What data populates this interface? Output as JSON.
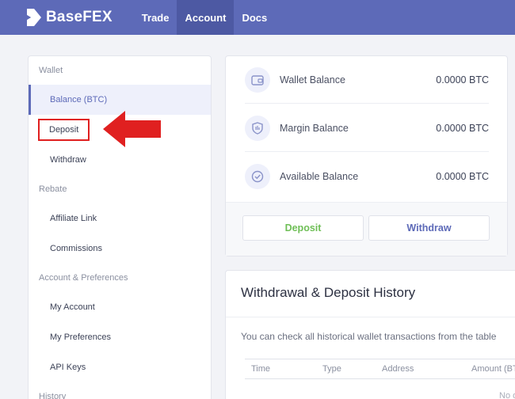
{
  "brand": {
    "name": "BaseFEX"
  },
  "nav": {
    "items": [
      {
        "label": "Trade",
        "active": false
      },
      {
        "label": "Account",
        "active": true
      },
      {
        "label": "Docs",
        "active": false
      }
    ]
  },
  "sidebar": {
    "wallet_heading": "Wallet",
    "balance_item": "Balance (BTC)",
    "deposit_item": "Deposit",
    "withdraw_item": "Withdraw",
    "rebate_heading": "Rebate",
    "affiliate_item": "Affiliate Link",
    "commissions_item": "Commissions",
    "account_heading": "Account & Preferences",
    "my_account_item": "My Account",
    "my_preferences_item": "My Preferences",
    "api_keys_item": "API Keys",
    "history_heading": "History"
  },
  "balances": {
    "wallet_label": "Wallet Balance",
    "wallet_value": "0.0000 BTC",
    "margin_label": "Margin Balance",
    "margin_value": "0.0000 BTC",
    "available_label": "Available Balance",
    "available_value": "0.0000 BTC",
    "deposit_button": "Deposit",
    "withdraw_button": "Withdraw"
  },
  "history": {
    "title": "Withdrawal & Deposit History",
    "description": "You can check all historical wallet transactions from the table",
    "columns": [
      "Time",
      "Type",
      "Address",
      "Amount (BT"
    ],
    "empty_text": "No d"
  },
  "colors": {
    "topbar": "#5d6ab8",
    "accent": "#5d6ab8",
    "deposit_green": "#6fbf57",
    "annotation_red": "#e02020"
  }
}
